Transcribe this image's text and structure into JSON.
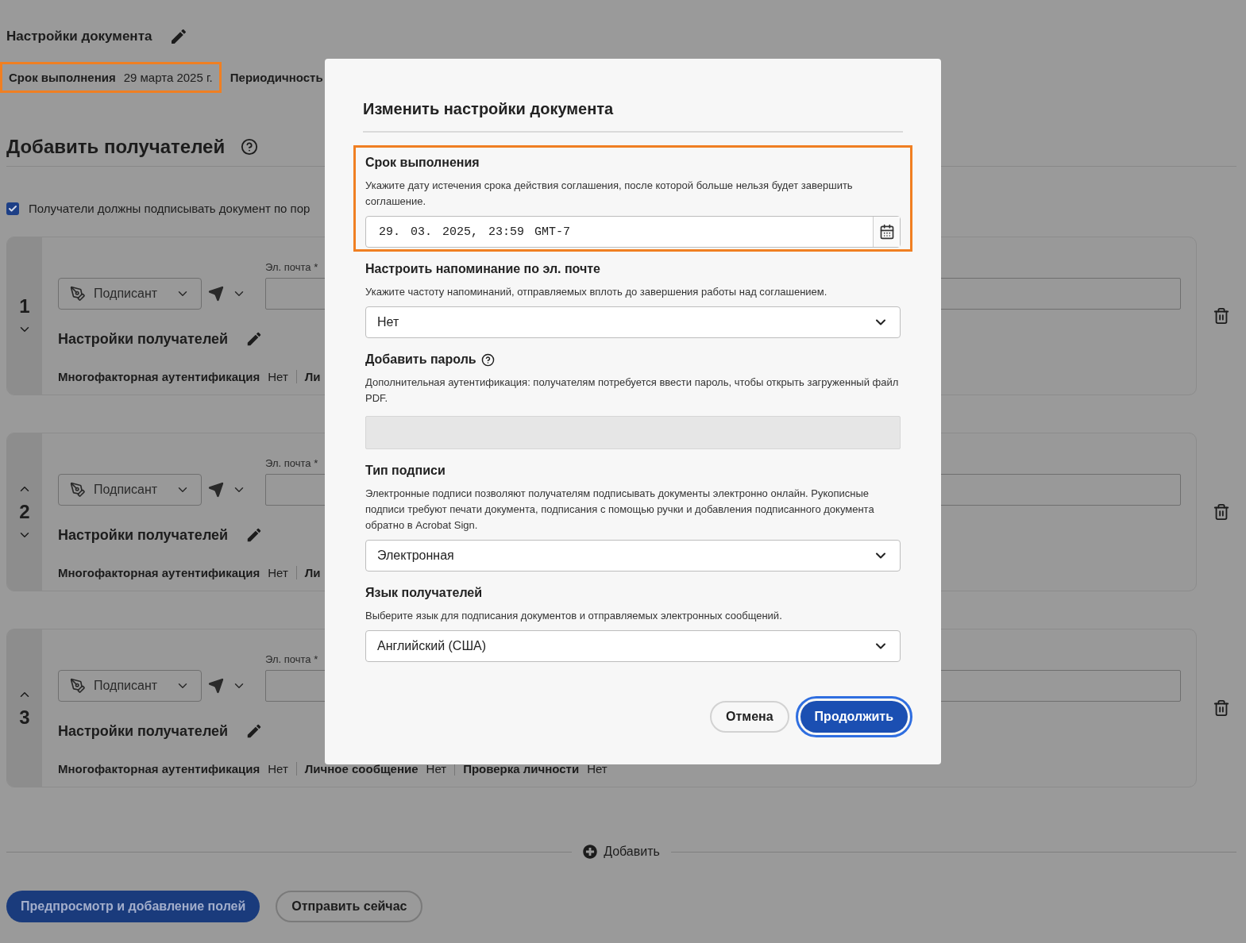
{
  "document_settings": {
    "title": "Настройки документа",
    "fields": [
      {
        "label": "Срок выполнения",
        "value": "29 марта 2025 г.",
        "highlighted": true
      },
      {
        "label": "Периодичность",
        "highlighted": false
      }
    ]
  },
  "recipients_section": {
    "title": "Добавить получателей",
    "sequential": {
      "label": "Получатели должны подписывать документ по пор",
      "checked": true
    }
  },
  "recipients": [
    {
      "number": "1",
      "move_up": false,
      "move_down": true,
      "role": "Подписант",
      "email_label": "Эл. почта",
      "required_mark": "*",
      "settings_title": "Настройки получателей",
      "settings": [
        {
          "label": "Многофакторная аутентификация",
          "value": "Нет"
        },
        {
          "label": "Ли"
        }
      ]
    },
    {
      "number": "2",
      "move_up": true,
      "move_down": true,
      "role": "Подписант",
      "email_label": "Эл. почта",
      "required_mark": "*",
      "settings_title": "Настройки получателей",
      "settings": [
        {
          "label": "Многофакторная аутентификация",
          "value": "Нет"
        },
        {
          "label": "Ли"
        }
      ]
    },
    {
      "number": "3",
      "move_up": true,
      "move_down": false,
      "role": "Подписант",
      "email_label": "Эл. почта",
      "required_mark": "*",
      "settings_title": "Настройки получателей",
      "settings": [
        {
          "label": "Многофакторная аутентификация",
          "value": "Нет"
        },
        {
          "label": "Личное сообщение",
          "value": "Нет"
        },
        {
          "label": "Проверка личности",
          "value": "Нет"
        }
      ]
    }
  ],
  "add_button": "Добавить",
  "actions": [
    {
      "label": "Предпросмотр и добавление полей",
      "kind": "primary"
    },
    {
      "label": "Отправить сейчас",
      "kind": "secondary"
    }
  ],
  "dialog": {
    "title": "Изменить настройки документа",
    "sections": [
      {
        "kind": "datetime",
        "title": "Срок выполнения",
        "description": "Укажите дату истечения срока действия соглашения, после которой больше нельзя будет завершить соглашение.",
        "value": "29. 03. 2025, 23:59",
        "zone": "GMT-7",
        "highlighted": true
      },
      {
        "kind": "select",
        "title": "Настроить напоминание по эл. почте",
        "description": "Укажите частоту напоминаний, отправляемых вплоть до завершения работы над соглашением.",
        "value": "Нет",
        "highlighted": false
      },
      {
        "kind": "password",
        "title": "Добавить пароль",
        "help": true,
        "description": "Дополнительная аутентификация: получателям потребуется ввести пароль, чтобы открыть загруженный файл PDF.",
        "disabled": true,
        "highlighted": false
      },
      {
        "kind": "select",
        "title": "Тип подписи",
        "description": "Электронные подписи позволяют получателям подписывать документы электронно онлайн. Рукописные подписи требуют печати документа, подписания с помощью ручки и добавления подписанного документа обратно в Acrobat Sign.",
        "value": "Электронная",
        "highlighted": false
      },
      {
        "kind": "select",
        "title": "Язык получателей",
        "description": "Выберите язык для подписания документов и отправляемых электронных сообщений.",
        "value": "Английский (США)",
        "highlighted": false
      }
    ],
    "buttons": [
      {
        "label": "Отмена",
        "kind": "secondary",
        "focused": false
      },
      {
        "label": "Продолжить",
        "kind": "primary",
        "focused": true
      }
    ]
  }
}
